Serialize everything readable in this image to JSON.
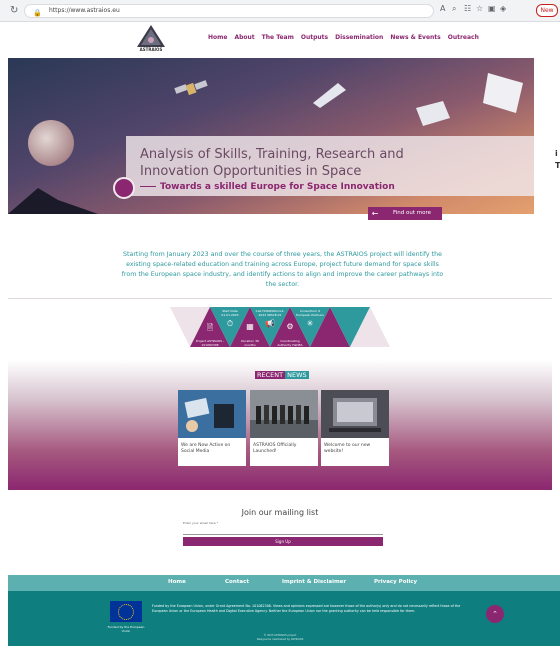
{
  "browser": {
    "url": "https://www.astraios.eu",
    "new_label": "New"
  },
  "header": {
    "logo_text": "ASTRAIOS",
    "menu": [
      "Home",
      "About",
      "The Team",
      "Outputs",
      "Dissemination",
      "News & Events",
      "Outreach"
    ]
  },
  "hero": {
    "title": "Analysis of Skills, Training, Research and Innovation Opportunities in Space",
    "subtitle": "Towards a skilled Europe for Space Innovation",
    "button": "Find out more",
    "edge_text_1": "i",
    "edge_text_2": "T"
  },
  "intro": {
    "text": "Starting from January 2023 and over the course of three years, the ASTRAIOS project will identify the existing space-related education and training across Europe, project future demand for space skills from the European space industry, and identify actions to align and improve the career pathways into the sector."
  },
  "triangles": [
    {
      "label": "Project ASTRAIOS - 101082308",
      "icon": "document-icon"
    },
    {
      "label": "Start Date 01.01.2023",
      "icon": "stopwatch-icon"
    },
    {
      "label": "Duration 36 months",
      "icon": "calendar-icon"
    },
    {
      "label": "Call HORIZON-CL4-2022 SPACE-01",
      "icon": "megaphone-icon"
    },
    {
      "label": "Coordinating Authority HaDEA",
      "icon": "gear-icon"
    },
    {
      "label": "Consortium 9 European Partners",
      "icon": "network-icon"
    }
  ],
  "news": {
    "heading_a": "RECENT",
    "heading_b": "NEWS",
    "cards": [
      {
        "title": "We are Now Active on Social Media"
      },
      {
        "title": "ASTRAIOS Officially Launched!"
      },
      {
        "title": "Welcome to our new website!"
      }
    ]
  },
  "mailing": {
    "title": "Join our mailing list",
    "label": "Enter your email here *",
    "button": "Sign Up"
  },
  "footer": {
    "nav": [
      "Home",
      "Contact",
      "Imprint & Disclaimer",
      "Privacy Policy"
    ],
    "eu_caption": "Funded by the European Union",
    "disclaimer": "Funded by the European Union, under Grant Agreement No. 101082308. Views and opinions expressed are however those of the author(s) only and do not necessarily reflect those of the European Union or the European Health and Digital Executive Agency. Neither the European Union nor the granting authority can be held responsible for them.",
    "copyright": "© 2023 ASTRAIOS project",
    "copyright_2": "Designed & maintained by ASTRAIOS"
  },
  "colors": {
    "brand": "#8b2770",
    "teal": "#2f9a9e",
    "footer": "#0e7e7e"
  }
}
